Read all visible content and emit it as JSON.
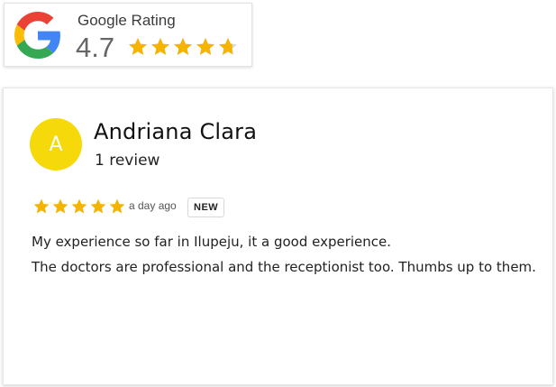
{
  "rating_badge": {
    "title": "Google Rating",
    "score": "4.7",
    "stars": 4.7,
    "star_color": "#f5b400",
    "logo_icon": "google-g-icon"
  },
  "review": {
    "avatar_letter": "A",
    "avatar_color": "#f5d90a",
    "reviewer_name": "Andriana Clara",
    "review_count": "1 review",
    "stars": 5,
    "date": "a day ago",
    "badge": "NEW",
    "text_lines": [
      "My experience so far in Ilupeju, it a good experience.",
      "The doctors are professional and the receptionist too. Thumbs up to them."
    ]
  }
}
